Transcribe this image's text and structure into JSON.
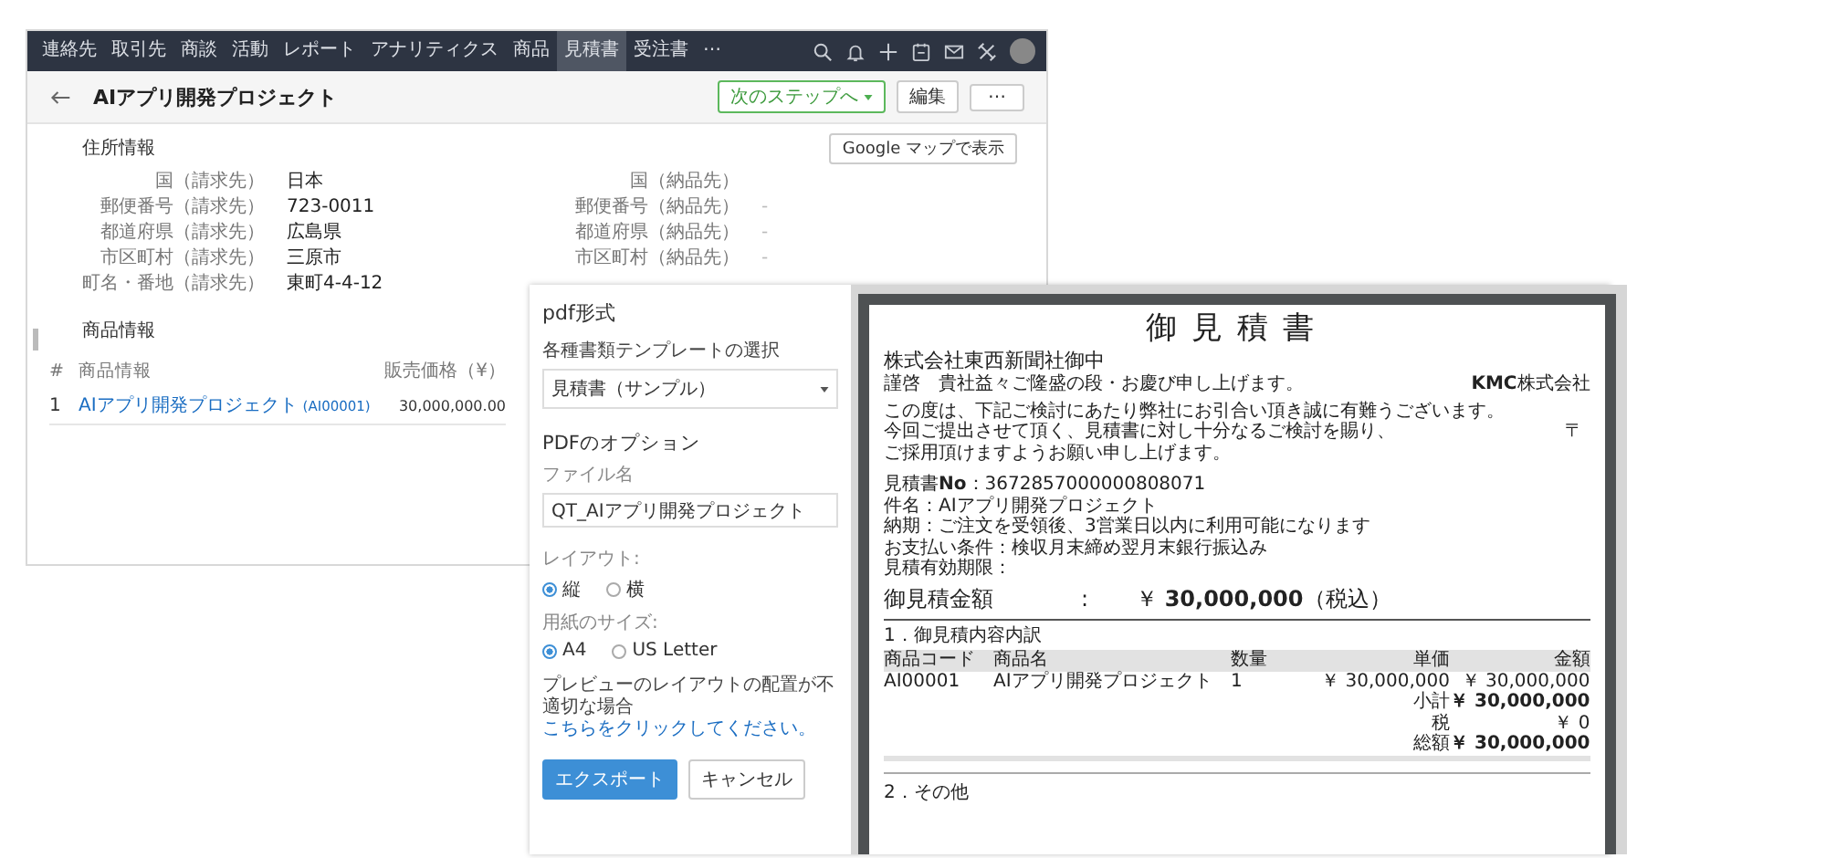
{
  "nav": {
    "items": [
      {
        "label": "連絡先",
        "selected": false
      },
      {
        "label": "取引先",
        "selected": false
      },
      {
        "label": "商談",
        "selected": false
      },
      {
        "label": "活動",
        "selected": false
      },
      {
        "label": "レポート",
        "selected": false
      },
      {
        "label": "アナリティクス",
        "selected": false
      },
      {
        "label": "商品",
        "selected": false
      },
      {
        "label": "見積書",
        "selected": true
      },
      {
        "label": "受注書",
        "selected": false
      }
    ],
    "more": "⋯"
  },
  "record": {
    "title": "AIアプリ開発プロジェクト",
    "next_button": "次のステップへ",
    "edit_button": "編集",
    "more_button": "⋯"
  },
  "address": {
    "title": "住所情報",
    "map_button": "Google マップで表示",
    "rows": [
      {
        "billing_label": "国（請求先）",
        "billing_value": "日本",
        "shipping_label": "国（納品先）",
        "shipping_value": ""
      },
      {
        "billing_label": "郵便番号（請求先）",
        "billing_value": "723-0011",
        "shipping_label": "郵便番号（納品先）",
        "shipping_value": "-"
      },
      {
        "billing_label": "都道府県（請求先）",
        "billing_value": "広島県",
        "shipping_label": "都道府県（納品先）",
        "shipping_value": "-"
      },
      {
        "billing_label": "市区町村（請求先）",
        "billing_value": "三原市",
        "shipping_label": "市区町村（納品先）",
        "shipping_value": "-"
      },
      {
        "billing_label": "町名・番地（請求先）",
        "billing_value": "東町4-4-12",
        "shipping_label": "",
        "shipping_value": ""
      }
    ]
  },
  "products": {
    "title": "商品情報",
    "columns": [
      "#",
      "商品情報",
      "販売価格（¥）"
    ],
    "rows": [
      {
        "index": "1",
        "name": "AIアプリ開発プロジェクト",
        "code": "(AI00001)",
        "price": "30,000,000.00"
      }
    ]
  },
  "export": {
    "title": "pdf形式",
    "template_label": "各種書類テンプレートの選択",
    "template_value": "見積書（サンプル）",
    "options_title": "PDFのオプション",
    "filename_label": "ファイル名",
    "filename_value": "QT_AIアプリ開発プロジェクト",
    "layout_label": "レイアウト:",
    "layout_options": [
      {
        "label": "縦",
        "selected": true
      },
      {
        "label": "横",
        "selected": false
      }
    ],
    "paper_label": "用紙のサイズ:",
    "paper_options": [
      {
        "label": "A4",
        "selected": true
      },
      {
        "label": "US Letter",
        "selected": false
      }
    ],
    "note": "プレビューのレイアウトの配置が不適切な場合",
    "note_link": "こちらをクリックしてください。",
    "export_button": "エクスポート",
    "cancel_button": "キャンセル"
  },
  "document": {
    "title": "御見積書",
    "addressee": "株式会社東西新聞社御中",
    "greeting": "謹啓　貴社益々ご隆盛の段・お慶び申し上げます。",
    "company": "**KMC**株式会社",
    "postal_mark": "〒",
    "body_lines": [
      "この度は、下記ご検討にあたり弊社にお引合い頂き誠に有難うございます。",
      "今回ご提出させて頂く、見積書に対し十分なるご検討を賜り、",
      "ご採用頂けますようお願い申し上げます。"
    ],
    "details": [
      "見積書**No**：3672857000000808071",
      "件名：AIアプリ開発プロジェクト",
      "納期：ご注文を受領後、3営業日以内に利用可能になります",
      "お支払い条件：検収月末締め翌月末銀行振込み",
      "見積有効期限："
    ],
    "amount_label": "御見積金額",
    "amount_separator": ":",
    "amount_value": "￥ **30,000,000**（税込）",
    "section_1": "1．御見積内容内訳",
    "columns": [
      "商品コード",
      "商品名",
      "数量",
      "単価",
      "金額"
    ],
    "rows": [
      [
        "AI00001",
        "AIアプリ開発プロジェクト",
        "1",
        "￥ 30,000,000",
        "￥ 30,000,000"
      ]
    ],
    "totals": [
      {
        "label": "小計",
        "value": "￥ 30,000,000",
        "emphasis": true
      },
      {
        "label": "税",
        "value": "￥ 0",
        "emphasis": false
      },
      {
        "label": "総額",
        "value": "￥ 30,000,000",
        "emphasis": true
      }
    ],
    "section_2": "2．その他"
  }
}
